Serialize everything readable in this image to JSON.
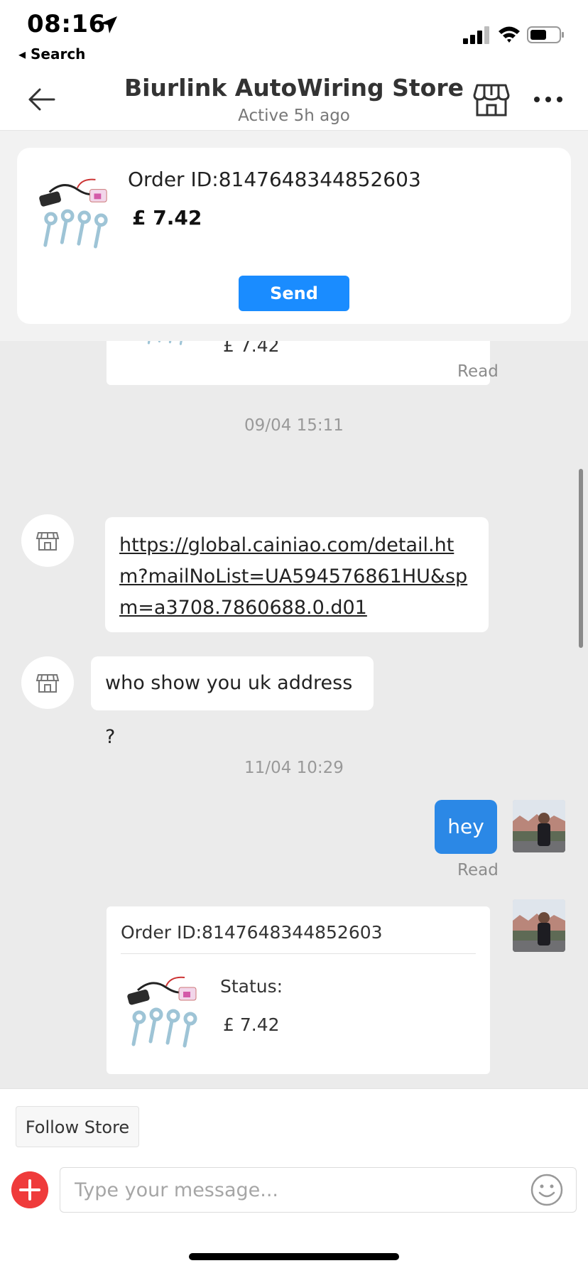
{
  "status_bar": {
    "time": "08:16",
    "back_label": "◂ Search"
  },
  "header": {
    "store_name": "Biurlink AutoWiring Store",
    "active_status": "Active 5h ago"
  },
  "pinned_order": {
    "order_id": "Order ID:8147648344852603",
    "price": "£ 7.42",
    "send_label": "Send"
  },
  "chat": {
    "partial_card_price": "£ 7.42",
    "read_label_1": "Read",
    "timestamp_1": "09/04 15:11",
    "msg_link": "https://global.cainiao.com/detail.htm?mailNoList=UA594576861HU&spm=a3708.7860688.0.d01",
    "msg_who": "who show you uk address ?",
    "timestamp_2": "11/04 10:29",
    "msg_hey": "hey",
    "read_label_2": "Read",
    "order_card": {
      "order_id": "Order ID:8147648344852603",
      "status_label": "Status:",
      "price": "£ 7.42"
    }
  },
  "bottom_bar": {
    "follow_label": "Follow Store",
    "input_placeholder": "Type your message..."
  },
  "colors": {
    "accent": "#1a8cff",
    "outgoing_bubble": "#2b88e6",
    "plus_button": "#ef3b3b"
  }
}
